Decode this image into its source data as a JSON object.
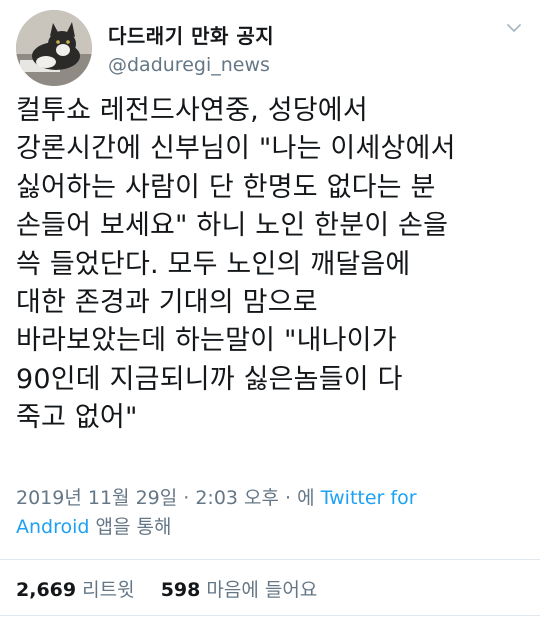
{
  "account": {
    "display_name": "다드래기 만화 공지",
    "handle": "@daduregi_news",
    "avatar_icon": "cat-avatar-icon",
    "menu_icon": "chevron-down-icon"
  },
  "tweet": {
    "lines": [
      "컬투쇼 레전드사연중, 성당에서",
      "강론시간에 신부님이 \"나는 이세상에서",
      "싫어하는 사람이 단 한명도 없다는 분",
      "손들어 보세요\" 하니 노인 한분이 손을",
      "쓱 들었단다. 모두 노인의 깨달음에",
      "대한 존경과 기대의 맘으로",
      "바라보았는데 하는말이 \"내나이가",
      "90인데 지금되니까 싫은놈들이 다",
      "죽고 없어\""
    ],
    "timestamp": "2019년 11월 29일 · 2:03 오후 · 에",
    "source_prefix": "Twitter for",
    "source_suffix": "Android",
    "via": "앱을 통해"
  },
  "stats": {
    "retweets_count": "2,669",
    "retweets_label": "리트윗",
    "likes_count": "598",
    "likes_label": "마음에 들어요"
  },
  "colors": {
    "link": "#1da1f2",
    "muted": "#657786",
    "text": "#14171a",
    "divider": "#e1e8ed"
  }
}
